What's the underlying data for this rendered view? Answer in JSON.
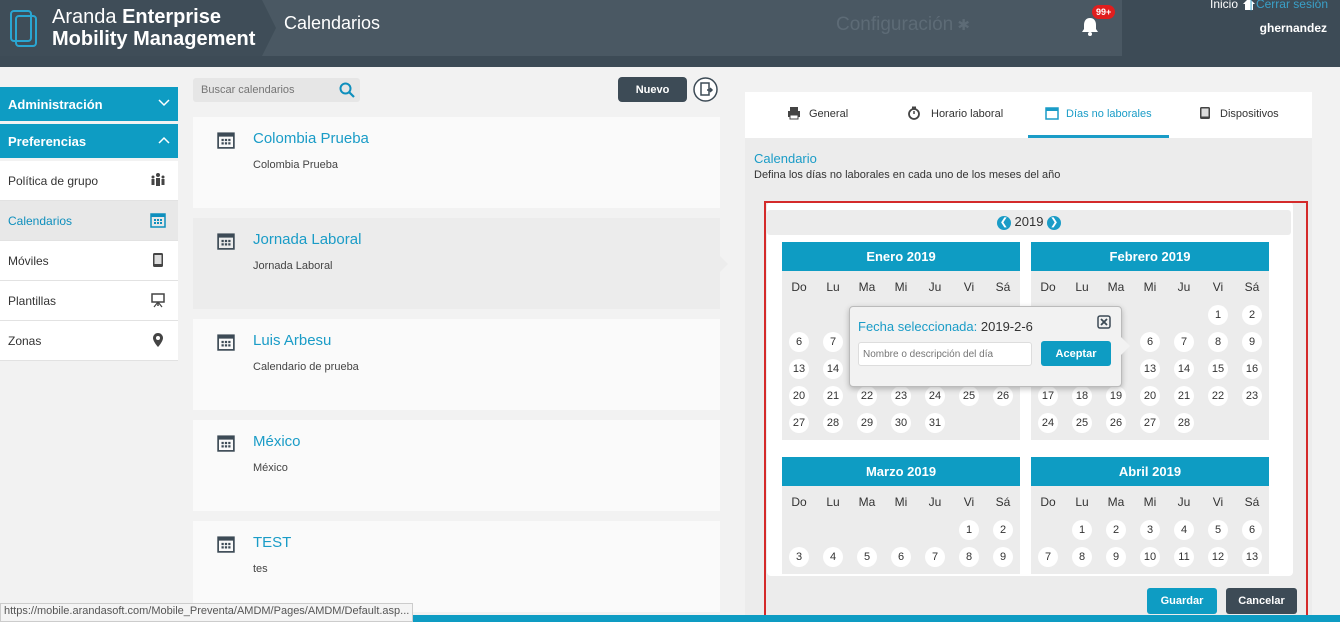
{
  "app": {
    "brand_light": "Aranda",
    "brand_bold_1": "Enterprise",
    "brand_bold_2": "Mobility Management",
    "page_title": "Calendarios",
    "config_label": "Configuración",
    "badge": "99+",
    "inicio": "Inicio",
    "logout": "| Cerrar sesión",
    "username": "ghernandez"
  },
  "sidebar": {
    "sections": [
      {
        "label": "Administración",
        "icon": "chevron-down-icon"
      },
      {
        "label": "Preferencias",
        "icon": "chevron-up-icon"
      }
    ],
    "items": [
      {
        "label": "Política de grupo",
        "icon": "group-icon"
      },
      {
        "label": "Calendarios",
        "icon": "calendar-icon"
      },
      {
        "label": "Móviles",
        "icon": "mobile-icon"
      },
      {
        "label": "Plantillas",
        "icon": "template-icon"
      },
      {
        "label": "Zonas",
        "icon": "location-icon"
      }
    ]
  },
  "search": {
    "placeholder": "Buscar calendarios"
  },
  "toolbar": {
    "new_label": "Nuevo"
  },
  "calendars": [
    {
      "name": "Colombia Prueba",
      "desc": "Colombia Prueba"
    },
    {
      "name": "Jornada Laboral",
      "desc": "Jornada Laboral"
    },
    {
      "name": "Luis Arbesu",
      "desc": "Calendario de prueba"
    },
    {
      "name": "México",
      "desc": "México"
    },
    {
      "name": "TEST",
      "desc": "tes"
    }
  ],
  "tabs": [
    {
      "label": "General",
      "icon": "printer-icon"
    },
    {
      "label": "Horario laboral",
      "icon": "stopwatch-icon"
    },
    {
      "label": "Días no laborales",
      "icon": "calendar-icon"
    },
    {
      "label": "Dispositivos",
      "icon": "device-icon"
    }
  ],
  "panel": {
    "title": "Calendario",
    "subtitle": "Defina los días no laborales en cada uno de los meses del año",
    "year": "2019"
  },
  "weekdays": [
    "Do",
    "Lu",
    "Ma",
    "Mi",
    "Ju",
    "Vi",
    "Sá"
  ],
  "months": [
    {
      "name": "Enero 2019",
      "weeks": [
        [
          "",
          "",
          "",
          "",
          "",
          "",
          ""
        ],
        [
          "6",
          "7",
          "",
          "",
          "",
          "",
          ""
        ],
        [
          "13",
          "14",
          "",
          "",
          "",
          "",
          ""
        ],
        [
          "20",
          "21",
          "22",
          "23",
          "24",
          "25",
          "26"
        ],
        [
          "27",
          "28",
          "29",
          "30",
          "31",
          "",
          ""
        ]
      ]
    },
    {
      "name": "Febrero 2019",
      "weeks": [
        [
          "",
          "",
          "",
          "",
          "",
          "1",
          "2"
        ],
        [
          "",
          "",
          "",
          "6",
          "7",
          "8",
          "9"
        ],
        [
          "",
          "",
          "",
          "13",
          "14",
          "15",
          "16"
        ],
        [
          "17",
          "18",
          "19",
          "20",
          "21",
          "22",
          "23"
        ],
        [
          "24",
          "25",
          "26",
          "27",
          "28",
          "",
          ""
        ]
      ]
    },
    {
      "name": "Marzo 2019",
      "weeks": [
        [
          "",
          "",
          "",
          "",
          "",
          "1",
          "2"
        ],
        [
          "3",
          "4",
          "5",
          "6",
          "7",
          "8",
          "9"
        ]
      ]
    },
    {
      "name": "Abril 2019",
      "weeks": [
        [
          "",
          "1",
          "2",
          "3",
          "4",
          "5",
          "6"
        ],
        [
          "7",
          "8",
          "9",
          "10",
          "11",
          "12",
          "13"
        ]
      ]
    }
  ],
  "popover": {
    "label": "Fecha seleccionada:",
    "date": "2019-2-6",
    "placeholder": "Nombre o descripción del día",
    "button": "Aceptar"
  },
  "actions": {
    "save": "Guardar",
    "cancel": "Cancelar"
  },
  "status_url": "https://mobile.arandasoft.com/Mobile_Preventa/AMDM/Pages/AMDM/Default.asp..."
}
